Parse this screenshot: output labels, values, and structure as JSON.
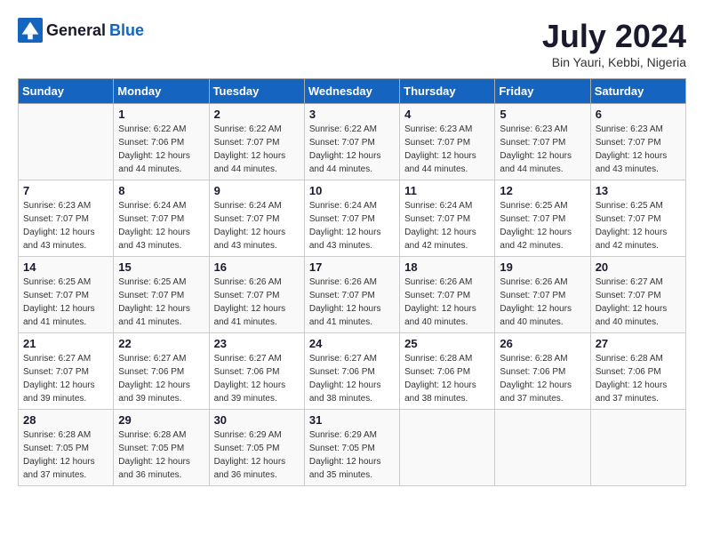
{
  "header": {
    "logo_general": "General",
    "logo_blue": "Blue",
    "month_year": "July 2024",
    "location": "Bin Yauri, Kebbi, Nigeria"
  },
  "days_of_week": [
    "Sunday",
    "Monday",
    "Tuesday",
    "Wednesday",
    "Thursday",
    "Friday",
    "Saturday"
  ],
  "weeks": [
    [
      {
        "day": "",
        "sunrise": "",
        "sunset": "",
        "daylight": ""
      },
      {
        "day": "1",
        "sunrise": "Sunrise: 6:22 AM",
        "sunset": "Sunset: 7:06 PM",
        "daylight": "Daylight: 12 hours and 44 minutes."
      },
      {
        "day": "2",
        "sunrise": "Sunrise: 6:22 AM",
        "sunset": "Sunset: 7:07 PM",
        "daylight": "Daylight: 12 hours and 44 minutes."
      },
      {
        "day": "3",
        "sunrise": "Sunrise: 6:22 AM",
        "sunset": "Sunset: 7:07 PM",
        "daylight": "Daylight: 12 hours and 44 minutes."
      },
      {
        "day": "4",
        "sunrise": "Sunrise: 6:23 AM",
        "sunset": "Sunset: 7:07 PM",
        "daylight": "Daylight: 12 hours and 44 minutes."
      },
      {
        "day": "5",
        "sunrise": "Sunrise: 6:23 AM",
        "sunset": "Sunset: 7:07 PM",
        "daylight": "Daylight: 12 hours and 44 minutes."
      },
      {
        "day": "6",
        "sunrise": "Sunrise: 6:23 AM",
        "sunset": "Sunset: 7:07 PM",
        "daylight": "Daylight: 12 hours and 43 minutes."
      }
    ],
    [
      {
        "day": "7",
        "sunrise": "Sunrise: 6:23 AM",
        "sunset": "Sunset: 7:07 PM",
        "daylight": "Daylight: 12 hours and 43 minutes."
      },
      {
        "day": "8",
        "sunrise": "Sunrise: 6:24 AM",
        "sunset": "Sunset: 7:07 PM",
        "daylight": "Daylight: 12 hours and 43 minutes."
      },
      {
        "day": "9",
        "sunrise": "Sunrise: 6:24 AM",
        "sunset": "Sunset: 7:07 PM",
        "daylight": "Daylight: 12 hours and 43 minutes."
      },
      {
        "day": "10",
        "sunrise": "Sunrise: 6:24 AM",
        "sunset": "Sunset: 7:07 PM",
        "daylight": "Daylight: 12 hours and 43 minutes."
      },
      {
        "day": "11",
        "sunrise": "Sunrise: 6:24 AM",
        "sunset": "Sunset: 7:07 PM",
        "daylight": "Daylight: 12 hours and 42 minutes."
      },
      {
        "day": "12",
        "sunrise": "Sunrise: 6:25 AM",
        "sunset": "Sunset: 7:07 PM",
        "daylight": "Daylight: 12 hours and 42 minutes."
      },
      {
        "day": "13",
        "sunrise": "Sunrise: 6:25 AM",
        "sunset": "Sunset: 7:07 PM",
        "daylight": "Daylight: 12 hours and 42 minutes."
      }
    ],
    [
      {
        "day": "14",
        "sunrise": "Sunrise: 6:25 AM",
        "sunset": "Sunset: 7:07 PM",
        "daylight": "Daylight: 12 hours and 41 minutes."
      },
      {
        "day": "15",
        "sunrise": "Sunrise: 6:25 AM",
        "sunset": "Sunset: 7:07 PM",
        "daylight": "Daylight: 12 hours and 41 minutes."
      },
      {
        "day": "16",
        "sunrise": "Sunrise: 6:26 AM",
        "sunset": "Sunset: 7:07 PM",
        "daylight": "Daylight: 12 hours and 41 minutes."
      },
      {
        "day": "17",
        "sunrise": "Sunrise: 6:26 AM",
        "sunset": "Sunset: 7:07 PM",
        "daylight": "Daylight: 12 hours and 41 minutes."
      },
      {
        "day": "18",
        "sunrise": "Sunrise: 6:26 AM",
        "sunset": "Sunset: 7:07 PM",
        "daylight": "Daylight: 12 hours and 40 minutes."
      },
      {
        "day": "19",
        "sunrise": "Sunrise: 6:26 AM",
        "sunset": "Sunset: 7:07 PM",
        "daylight": "Daylight: 12 hours and 40 minutes."
      },
      {
        "day": "20",
        "sunrise": "Sunrise: 6:27 AM",
        "sunset": "Sunset: 7:07 PM",
        "daylight": "Daylight: 12 hours and 40 minutes."
      }
    ],
    [
      {
        "day": "21",
        "sunrise": "Sunrise: 6:27 AM",
        "sunset": "Sunset: 7:07 PM",
        "daylight": "Daylight: 12 hours and 39 minutes."
      },
      {
        "day": "22",
        "sunrise": "Sunrise: 6:27 AM",
        "sunset": "Sunset: 7:06 PM",
        "daylight": "Daylight: 12 hours and 39 minutes."
      },
      {
        "day": "23",
        "sunrise": "Sunrise: 6:27 AM",
        "sunset": "Sunset: 7:06 PM",
        "daylight": "Daylight: 12 hours and 39 minutes."
      },
      {
        "day": "24",
        "sunrise": "Sunrise: 6:27 AM",
        "sunset": "Sunset: 7:06 PM",
        "daylight": "Daylight: 12 hours and 38 minutes."
      },
      {
        "day": "25",
        "sunrise": "Sunrise: 6:28 AM",
        "sunset": "Sunset: 7:06 PM",
        "daylight": "Daylight: 12 hours and 38 minutes."
      },
      {
        "day": "26",
        "sunrise": "Sunrise: 6:28 AM",
        "sunset": "Sunset: 7:06 PM",
        "daylight": "Daylight: 12 hours and 37 minutes."
      },
      {
        "day": "27",
        "sunrise": "Sunrise: 6:28 AM",
        "sunset": "Sunset: 7:06 PM",
        "daylight": "Daylight: 12 hours and 37 minutes."
      }
    ],
    [
      {
        "day": "28",
        "sunrise": "Sunrise: 6:28 AM",
        "sunset": "Sunset: 7:05 PM",
        "daylight": "Daylight: 12 hours and 37 minutes."
      },
      {
        "day": "29",
        "sunrise": "Sunrise: 6:28 AM",
        "sunset": "Sunset: 7:05 PM",
        "daylight": "Daylight: 12 hours and 36 minutes."
      },
      {
        "day": "30",
        "sunrise": "Sunrise: 6:29 AM",
        "sunset": "Sunset: 7:05 PM",
        "daylight": "Daylight: 12 hours and 36 minutes."
      },
      {
        "day": "31",
        "sunrise": "Sunrise: 6:29 AM",
        "sunset": "Sunset: 7:05 PM",
        "daylight": "Daylight: 12 hours and 35 minutes."
      },
      {
        "day": "",
        "sunrise": "",
        "sunset": "",
        "daylight": ""
      },
      {
        "day": "",
        "sunrise": "",
        "sunset": "",
        "daylight": ""
      },
      {
        "day": "",
        "sunrise": "",
        "sunset": "",
        "daylight": ""
      }
    ]
  ]
}
